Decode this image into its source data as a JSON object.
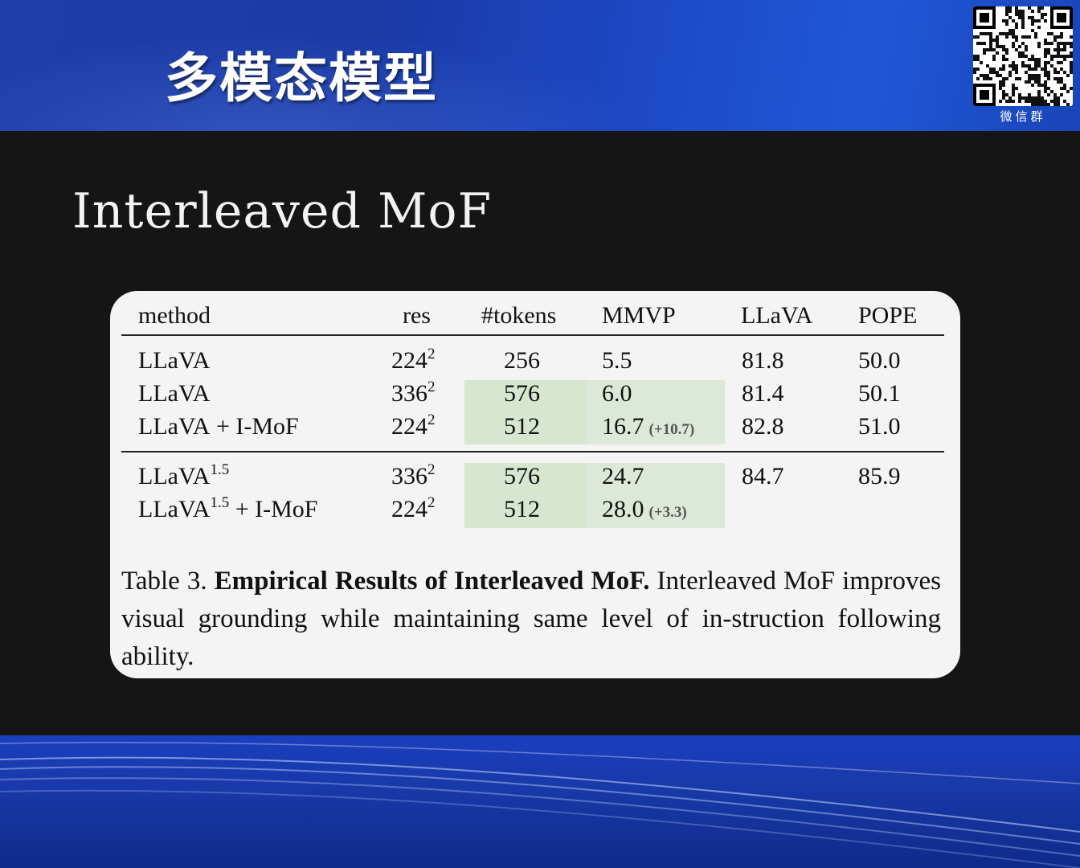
{
  "banner": {
    "title": "多模态模型",
    "qr_label": "微信群"
  },
  "slide": {
    "heading": "Interleaved MoF"
  },
  "table": {
    "headers": [
      "method",
      "res",
      "#tokens",
      "MMVP",
      "LLaVA",
      "POPE"
    ],
    "rows": [
      {
        "method": "LLaVA",
        "method_sup": "",
        "method_suffix": "",
        "res": "224",
        "res_sup": "2",
        "tokens": "256",
        "mmvp": "5.5",
        "mmvp_delta": "",
        "llava": "81.8",
        "pope": "50.0"
      },
      {
        "method": "LLaVA",
        "method_sup": "",
        "method_suffix": "",
        "res": "336",
        "res_sup": "2",
        "tokens": "576",
        "mmvp": "6.0",
        "mmvp_delta": "",
        "llava": "81.4",
        "pope": "50.1"
      },
      {
        "method": "LLaVA",
        "method_sup": "",
        "method_suffix": " + I-MoF",
        "res": "224",
        "res_sup": "2",
        "tokens": "512",
        "mmvp": "16.7",
        "mmvp_delta": "(+10.7)",
        "llava": "82.8",
        "pope": "51.0"
      },
      {
        "method": "LLaVA",
        "method_sup": "1.5",
        "method_suffix": "",
        "res": "336",
        "res_sup": "2",
        "tokens": "576",
        "mmvp": "24.7",
        "mmvp_delta": "",
        "llava": "84.7",
        "pope": "85.9"
      },
      {
        "method": "LLaVA",
        "method_sup": "1.5",
        "method_suffix": " + I-MoF",
        "res": "224",
        "res_sup": "2",
        "tokens": "512",
        "mmvp": "28.0",
        "mmvp_delta": "(+3.3)",
        "llava": "",
        "pope": ""
      }
    ],
    "caption": {
      "label": "Table 3.",
      "bold": "Empirical Results of Interleaved MoF.",
      "text": "Interleaved MoF improves visual grounding while maintaining same level of in-struction following ability."
    },
    "highlight_color": "#d6e6cf"
  }
}
